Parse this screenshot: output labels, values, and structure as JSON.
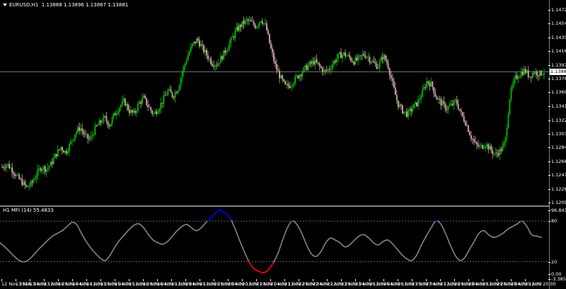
{
  "chart_header": {
    "symbol_timeframe": "EURUSD,H1",
    "ohlc": "1.13888 1.13896 1.13867 1.13881"
  },
  "indicator_header": {
    "label": "H1 MFI (14) 55.4833"
  },
  "current_price": "1.13881",
  "colors": {
    "background": "#000000",
    "bull_candle": "#00c000",
    "bear_candle": "#d8a8a8",
    "mfi_line": "#808080",
    "mfi_overbought": "#0000ff",
    "mfi_oversold": "#ff0000",
    "level_line": "#808080"
  },
  "price_axis_ticks": [
    "1.14725",
    "1.14540",
    "1.14350",
    "1.14165",
    "1.13970",
    "1.13785",
    "1.13600",
    "1.13410",
    "1.13220",
    "1.13035",
    "1.12845",
    "1.12660",
    "1.12470",
    "1.12280",
    "1.12095"
  ],
  "indicator_axis_ticks": [
    "96.8436",
    "80",
    "20",
    "0.00",
    "-3.3858"
  ],
  "time_axis_ticks": [
    "12 Nov 2018",
    "13 Nov 04:00",
    "13 Nov 12:00",
    "13 Nov 20:00",
    "14 Nov 04:00",
    "14 Nov 12:00",
    "14 Nov 20:00",
    "15 Nov 04:00",
    "15 Nov 12:00",
    "15 Nov 20:00",
    "16 Nov 04:00",
    "16 Nov 12:00",
    "19 Nov 04:00",
    "19 Nov 12:00",
    "19 Nov 20:00",
    "20 Nov 04:00",
    "20 Nov 12:00",
    "20 Nov 20:00",
    "21 Nov 04:00",
    "21 Nov 12:00",
    "21 Nov 20:00",
    "22 Nov 04:00",
    "22 Nov 12:00",
    "22 Nov 20:00",
    "23 Nov 04:00",
    "23 Nov 12:00",
    "26 Nov 04:00",
    "26 Nov 12:00",
    "26 Nov 20:00",
    "27 Nov 04:00",
    "27 Nov 12:00",
    "27 Nov 20:00",
    "28 Nov 04:00",
    "28 Nov 12:00",
    "28 Nov 20:00",
    "29 Nov 04:00",
    "29 Nov 12:00",
    "29 Nov 20:00"
  ],
  "chart_data": [
    {
      "type": "candlestick",
      "title": "EURUSD,H1",
      "ylim": [
        1.12095,
        1.1482
      ],
      "close_path": [
        1.1258,
        1.1262,
        1.1255,
        1.1245,
        1.1238,
        1.123,
        1.1235,
        1.1248,
        1.1258,
        1.1255,
        1.1262,
        1.1275,
        1.1285,
        1.1278,
        1.129,
        1.1305,
        1.1312,
        1.13,
        1.1295,
        1.131,
        1.1318,
        1.1325,
        1.1315,
        1.133,
        1.134,
        1.1348,
        1.1335,
        1.133,
        1.1345,
        1.1352,
        1.134,
        1.133,
        1.1338,
        1.135,
        1.1362,
        1.1355,
        1.1365,
        1.139,
        1.141,
        1.1425,
        1.1432,
        1.142,
        1.141,
        1.14,
        1.1398,
        1.1408,
        1.142,
        1.1432,
        1.1445,
        1.1452,
        1.1458,
        1.1455,
        1.145,
        1.146,
        1.145,
        1.142,
        1.1395,
        1.138,
        1.1368,
        1.137,
        1.1378,
        1.1385,
        1.1392,
        1.1398,
        1.1402,
        1.1395,
        1.1388,
        1.1392,
        1.1402,
        1.141,
        1.1412,
        1.1408,
        1.1402,
        1.1405,
        1.1412,
        1.1408,
        1.14,
        1.1395,
        1.141,
        1.1398,
        1.137,
        1.1345,
        1.1335,
        1.133,
        1.1338,
        1.1345,
        1.1358,
        1.1375,
        1.137,
        1.1352,
        1.1345,
        1.1338,
        1.1342,
        1.1348,
        1.133,
        1.1318,
        1.13,
        1.1288,
        1.1285,
        1.129,
        1.1282,
        1.1275,
        1.128,
        1.129,
        1.1355,
        1.1378,
        1.1385,
        1.139,
        1.1382,
        1.1388,
        1.1385,
        1.1388
      ]
    },
    {
      "type": "line",
      "title": "H1 MFI (14) 55.4833",
      "ylim": [
        -3.3858,
        96.8436
      ],
      "levels": [
        80,
        20
      ],
      "values": [
        48,
        42,
        35,
        28,
        22,
        20,
        23,
        30,
        38,
        45,
        52,
        58,
        62,
        66,
        72,
        78,
        75,
        62,
        50,
        40,
        32,
        25,
        22,
        30,
        42,
        52,
        60,
        68,
        74,
        76,
        70,
        60,
        52,
        48,
        46,
        50,
        58,
        66,
        72,
        75,
        70,
        66,
        70,
        78,
        85,
        92,
        96,
        92,
        85,
        70,
        52,
        35,
        20,
        10,
        6,
        4,
        8,
        18,
        32,
        52,
        70,
        80,
        75,
        62,
        45,
        32,
        28,
        35,
        48,
        55,
        52,
        48,
        42,
        45,
        52,
        58,
        60,
        55,
        48,
        45,
        50,
        52,
        46,
        38,
        30,
        24,
        22,
        30,
        45,
        58,
        70,
        80,
        76,
        62,
        45,
        30,
        22,
        26,
        38,
        50,
        62,
        66,
        60,
        56,
        58,
        62,
        68,
        72,
        76,
        80,
        72,
        60,
        58,
        56
      ]
    }
  ]
}
